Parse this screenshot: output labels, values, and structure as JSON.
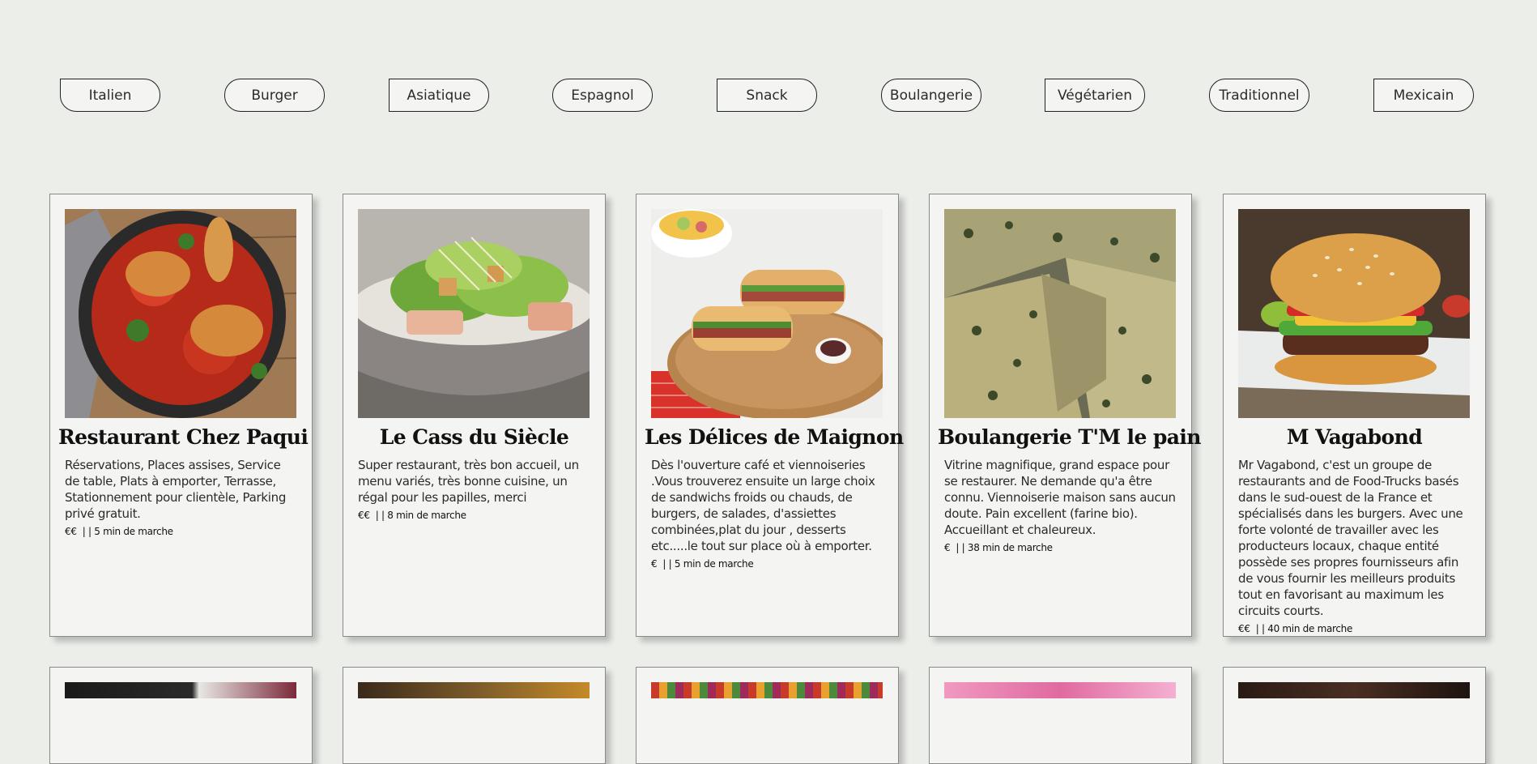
{
  "filters": [
    {
      "label": "Italien"
    },
    {
      "label": "Burger"
    },
    {
      "label": "Asiatique"
    },
    {
      "label": "Espagnol"
    },
    {
      "label": "Snack"
    },
    {
      "label": "Boulangerie"
    },
    {
      "label": "Végétarien"
    },
    {
      "label": "Traditionnel"
    },
    {
      "label": "Mexicain"
    }
  ],
  "restaurants": [
    {
      "name": "Restaurant Chez Paqui",
      "description": "Réservations, Places assises, Service de table, Plats à emporter, Terrasse, Stationnement pour clientèle, Parking privé gratuit.",
      "price": "€€",
      "separator": "| |",
      "distance": "5 min de marche"
    },
    {
      "name": "Le Cass du Siècle",
      "description": "Super restaurant, très bon accueil, un menu variés, très bonne cuisine, un régal pour les papilles, merci",
      "price": "€€",
      "separator": "| |",
      "distance": "8 min de marche"
    },
    {
      "name": "Les Délices de Maignon",
      "description": "Dès l'ouverture café et viennoiseries .Vous trouverez ensuite un large choix de sandwichs froids ou chauds, de burgers, de salades, d'assiettes combinées,plat du jour , desserts etc.....le tout sur place où à emporter.",
      "price": "€",
      "separator": "| |",
      "distance": "5 min de marche"
    },
    {
      "name": "Boulangerie T'M le pain",
      "description": "Vitrine magnifique, grand espace pour se restaurer. Ne demande qu'a être connu. Viennoiserie maison sans aucun doute. Pain excellent (farine bio). Accueillant et chaleureux.",
      "price": "€",
      "separator": "| |",
      "distance": "38 min de marche"
    },
    {
      "name": "M Vagabond",
      "description": "Mr Vagabond, c'est un groupe de restaurants and de Food-Trucks basés dans le sud-ouest de la France et spécialisés dans les burgers. Avec une forte volonté de travailler avec les producteurs locaux, chaque entité possède ses propres fournisseurs afin de vous fournir les meilleurs produits tout en favorisant au maximum les circuits courts.",
      "price": "€€",
      "separator": "| |",
      "distance": "40 min de marche"
    }
  ],
  "photos": [
    {
      "name": "chicken-stew-photo"
    },
    {
      "name": "caesar-salad-photo"
    },
    {
      "name": "sandwich-photo"
    },
    {
      "name": "quiche-photo"
    },
    {
      "name": "burger-photo"
    }
  ]
}
